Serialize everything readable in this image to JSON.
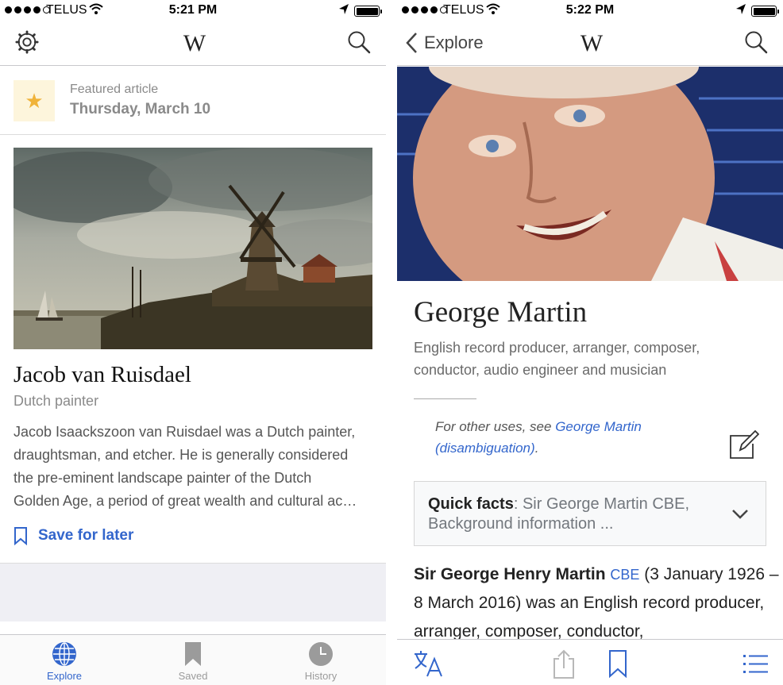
{
  "left": {
    "status": {
      "carrier": "TELUS",
      "time": "5:21 PM"
    },
    "nav": {
      "logo": "W"
    },
    "featured": {
      "kicker": "Featured article",
      "date": "Thursday, March 10",
      "title": "Jacob van Ruisdael",
      "subtitle": "Dutch painter",
      "body_lines": [
        "Jacob Isaackszoon van Ruisdael was a Dutch painter,",
        "draughtsman, and etcher. He is generally considered",
        "the pre-eminent landscape painter of the Dutch",
        "Golden Age, a period of great wealth and cultural ac…"
      ],
      "save_label": "Save for later"
    },
    "tabs": [
      {
        "label": "Explore",
        "icon": "globe-icon",
        "active": true
      },
      {
        "label": "Saved",
        "icon": "bookmark-icon",
        "active": false
      },
      {
        "label": "History",
        "icon": "clock-icon",
        "active": false
      }
    ],
    "colors": {
      "accent": "#3366cc",
      "star": "#f0b33a",
      "star_bg": "#fdf5dc"
    }
  },
  "right": {
    "status": {
      "carrier": "TELUS",
      "time": "5:22 PM"
    },
    "nav": {
      "back_label": "Explore",
      "logo": "W"
    },
    "article": {
      "title": "George Martin",
      "description": "English record producer, arranger, composer, conductor, audio engineer and musician",
      "hatnote_prefix": "For other uses, see ",
      "hatnote_link": "George Martin (disambiguation)",
      "hatnote_suffix": ".",
      "quick_facts_label": "Quick facts",
      "quick_facts_text": ": Sir George Martin CBE, Background information ...",
      "lead_bold": "Sir George Henry Martin",
      "lead_link": "CBE",
      "lead_rest": " (3 January 1926 – 8 March 2016) was an English record producer, arranger, composer, conductor,"
    },
    "toolbar": [
      "language-icon",
      "share-icon",
      "bookmark-icon",
      "table-of-contents-icon"
    ]
  }
}
